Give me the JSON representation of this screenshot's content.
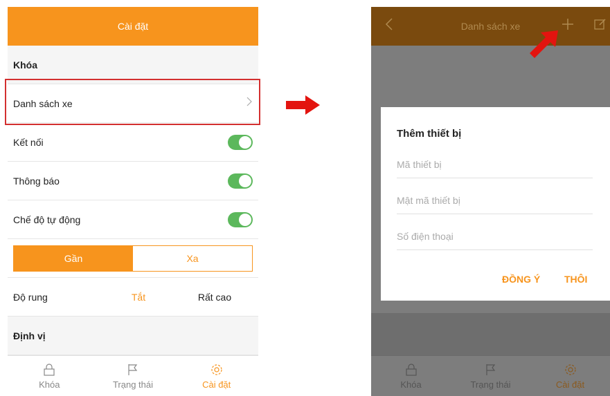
{
  "left": {
    "header_title": "Cài đặt",
    "section_lock": "Khóa",
    "row_vehicle_list": "Danh sách xe",
    "row_connect": "Kết nối",
    "row_notify": "Thông báo",
    "row_auto": "Chế độ tự động",
    "seg_near": "Gần",
    "seg_far": "Xa",
    "row_vibration": "Độ rung",
    "vib_off": "Tắt",
    "vib_very_high": "Rất cao",
    "section_locate": "Định vị",
    "tabs": [
      "Khóa",
      "Trạng thái",
      "Cài đặt"
    ],
    "toggles": {
      "connect": true,
      "notify": true,
      "auto": true
    }
  },
  "right": {
    "header_title": "Danh sách xe",
    "dialog_title": "Thêm thiết bị",
    "field_device_code": "Mã thiết bị",
    "field_device_password": "Mật mã thiết bị",
    "field_phone": "Số điện thoại",
    "btn_ok": "ĐỒNG Ý",
    "btn_cancel": "THÔI",
    "tabs": [
      "Khóa",
      "Trạng thái",
      "Cài đặt"
    ]
  },
  "colors": {
    "accent": "#f7941d",
    "toggle_on": "#5cb85c",
    "highlight": "#d32f2f"
  }
}
